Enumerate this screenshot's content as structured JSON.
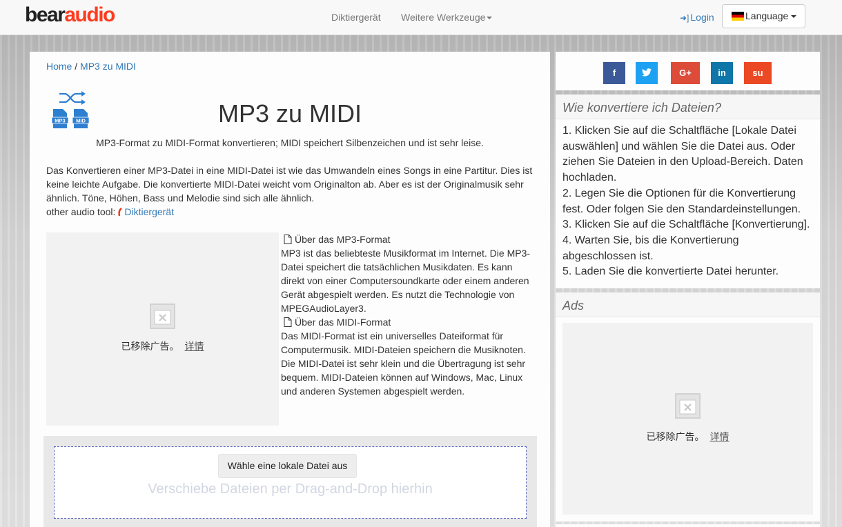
{
  "navbar": {
    "logo_part1": "bear",
    "logo_part2": "audio",
    "nav_items": [
      "Diktiergerät",
      "Weitere Werkzeuge"
    ],
    "login": "Login",
    "language": "Language"
  },
  "breadcrumb": {
    "home": "Home",
    "separator": " / ",
    "current": "MP3 zu MIDI"
  },
  "converter_icon": {
    "from": "MP3",
    "to": "MID"
  },
  "title": "MP3 zu MIDI",
  "subtitle": "MP3-Format zu MIDI-Format konvertieren; MIDI speichert Silbenzeichen und ist sehr leise.",
  "intro": {
    "text": "Das Konvertieren einer MP3-Datei in eine MIDI-Datei ist wie das Umwandeln eines Songs in eine Partitur. Dies ist keine leichte Aufgabe. Die konvertierte MIDI-Datei weicht vom Originalton ab. Aber es ist der Originalmusik sehr ähnlich. Töne, Höhen, Bass und Melodie sind sich alle ähnlich.",
    "other_label": "other audio tool:",
    "other_link": "Diktiergerät"
  },
  "ad_left": {
    "removed": "已移除广告。",
    "detail": "详情"
  },
  "format_info": {
    "mp3_heading": "Über das MP3-Format",
    "mp3_text": "MP3 ist das beliebteste Musikformat im Internet. Die MP3-Datei speichert die tatsächlichen Musikdaten. Es kann direkt von einer Computersoundkarte oder einem anderen Gerät abgespielt werden. Es nutzt die Technologie von MPEGAudioLayer3.",
    "midi_heading": "Über das MIDI-Format",
    "midi_text": "Das MIDI-Format ist ein universelles Dateiformat für Computermusik. MIDI-Dateien speichern die Musiknoten. Die MIDI-Datei ist sehr klein und die Übertragung ist sehr bequem. MIDI-Dateien können auf Windows, Mac, Linux und anderen Systemen abgespielt werden."
  },
  "upload": {
    "button": "Wähle eine lokale Datei aus",
    "drop_text": "Verschiebe Dateien per Drag-and-Drop hierhin"
  },
  "share": {
    "buttons": [
      {
        "label": "f",
        "color": "#3b5998"
      },
      {
        "label": "🐦",
        "color": "#1da1f2"
      },
      {
        "label": "G+",
        "color": "#dd4b39"
      },
      {
        "label": "in",
        "color": "#0e76a8"
      },
      {
        "label": "su",
        "color": "#eb4924"
      }
    ]
  },
  "howto": {
    "title": "Wie konvertiere ich Dateien?",
    "steps": [
      "1. Klicken Sie auf die Schaltfläche [Lokale Datei auswählen] und wählen Sie die Datei aus. Oder ziehen Sie Dateien in den Upload-Bereich. Daten hochladen.",
      "2. Legen Sie die Optionen für die Konvertierung fest. Oder folgen Sie den Standardeinstellungen.",
      "3. Klicken Sie auf die Schaltfläche [Konvertierung].",
      "4. Warten Sie, bis die Konvertierung abgeschlossen ist.",
      "5. Laden Sie die konvertierte Datei herunter."
    ]
  },
  "ads": {
    "title": "Ads",
    "removed": "已移除广告。",
    "detail": "详情"
  },
  "colors": {
    "link": "#337ab7",
    "logo_accent": "#ff3b1f",
    "icon_blue": "#2f7fd0"
  }
}
